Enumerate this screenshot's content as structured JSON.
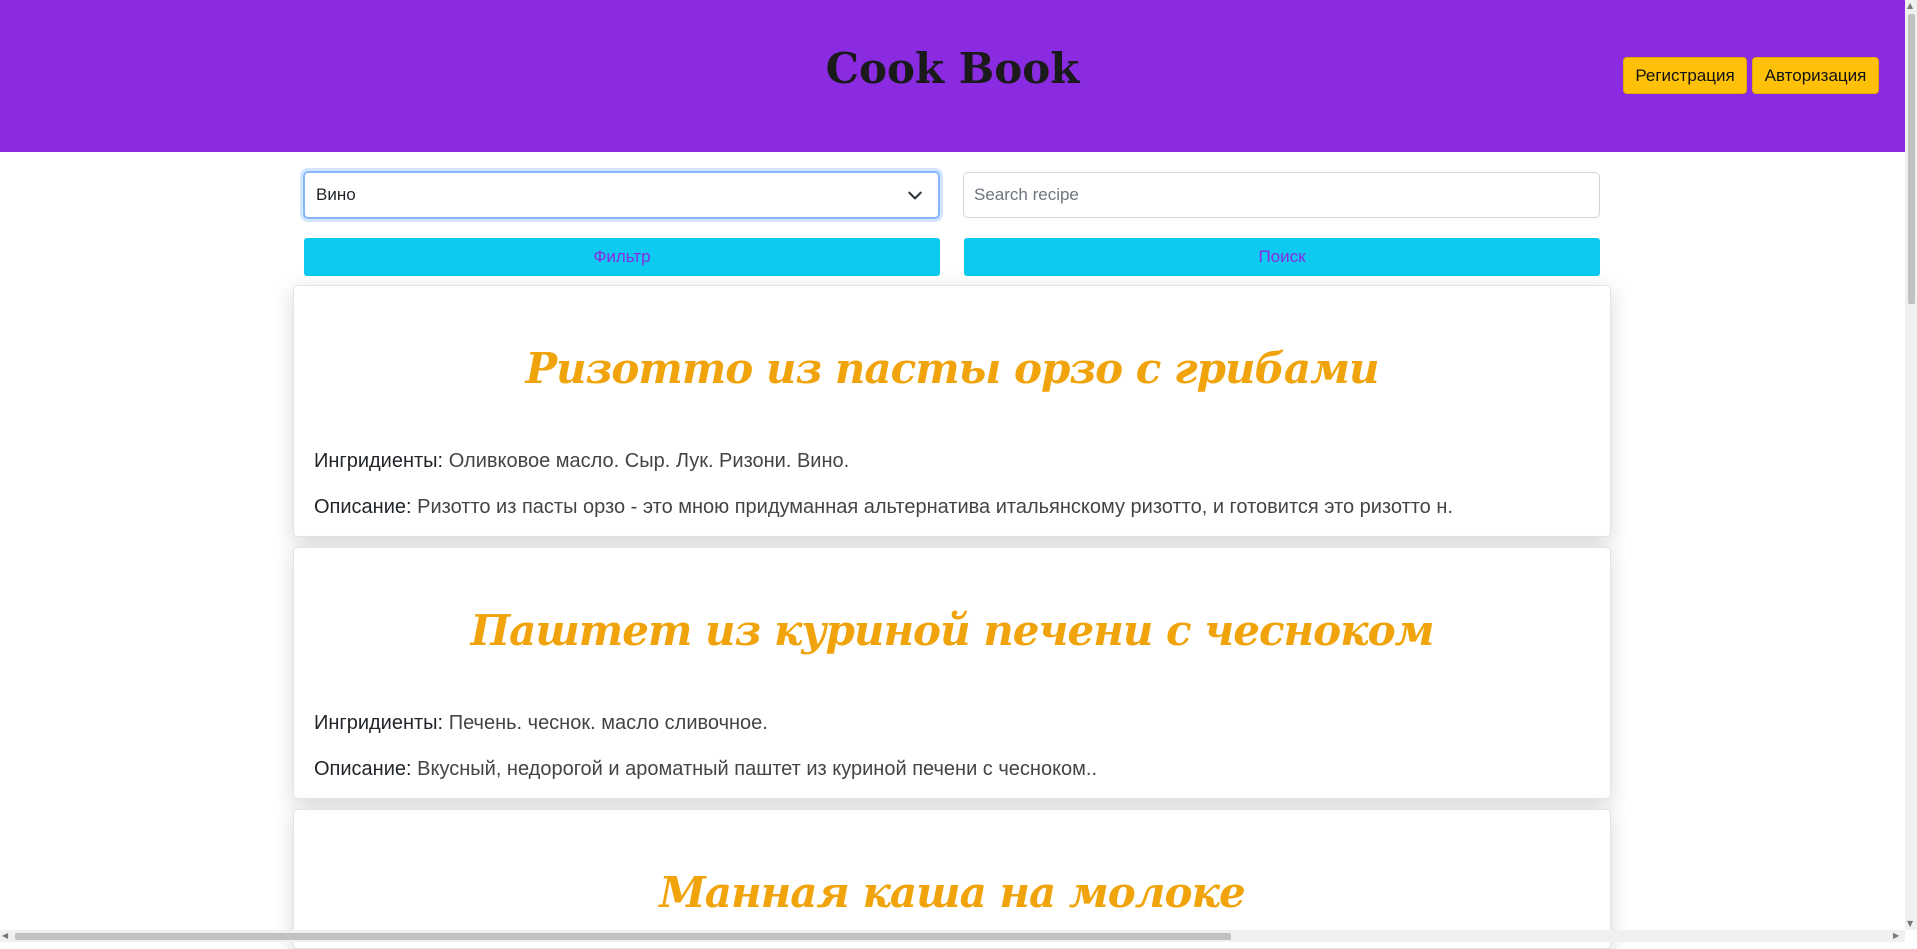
{
  "header": {
    "logo": "Cook Book",
    "register_label": "Регистрация",
    "login_label": "Авторизация",
    "background": "#8a2be2",
    "button_color": "#ffc107"
  },
  "filter": {
    "selected": "Вино",
    "search_placeholder": "Search recipe",
    "filter_button": "Фильтр",
    "search_button": "Поиск",
    "button_color": "#0dcaf0"
  },
  "labels": {
    "ingredients": "Ингридиенты:",
    "description": "Описание:"
  },
  "recipes": [
    {
      "title": "Ризотто из пасты орзо с грибами",
      "ingredients": "Оливковое масло. Сыр. Лук. Ризони. Вино.",
      "description": "Ризотто из пасты орзо - это мною придуманная альтернатива итальянскому ризотто, и готовится это ризотто н."
    },
    {
      "title": "Паштет из куриной печени с чесноком",
      "ingredients": "Печень. чеснок. масло сливочное.",
      "description": "Вкусный, недорогой и ароматный паштет из куриной печени с чесноком.."
    },
    {
      "title": "Манная каша на молоке"
    }
  ],
  "title_color": "#f0a30a"
}
